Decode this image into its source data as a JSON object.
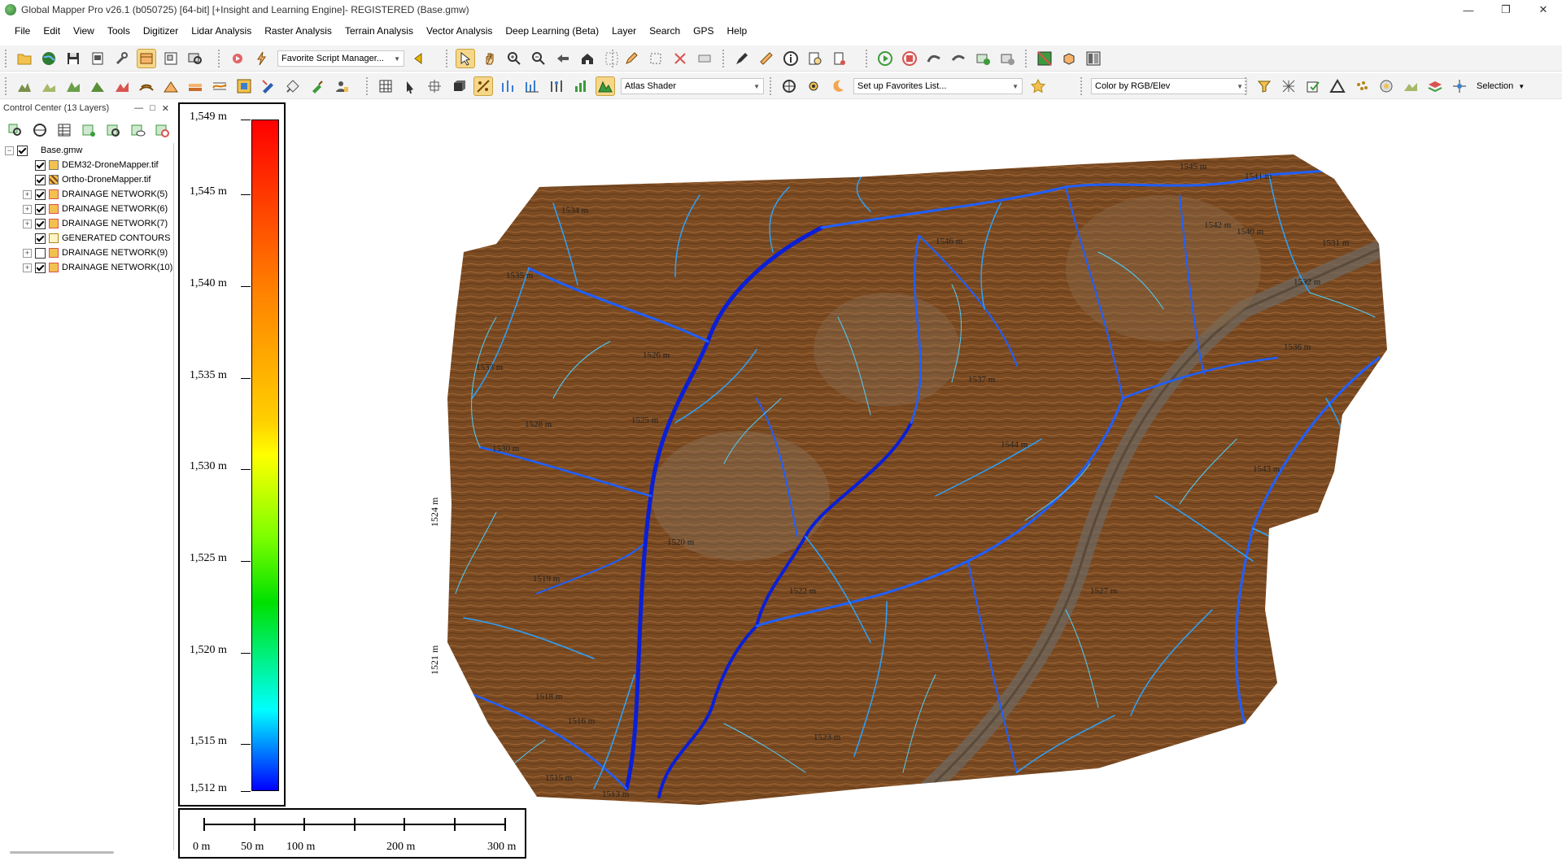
{
  "window": {
    "title": "Global Mapper Pro v26.1 (b050725) [64-bit] [+Insight and Learning Engine]- REGISTERED (Base.gmw)",
    "minimize": "—",
    "maximize": "❐",
    "close": "✕"
  },
  "menu": [
    "File",
    "Edit",
    "View",
    "Tools",
    "Digitizer",
    "Lidar Analysis",
    "Raster Analysis",
    "Terrain Analysis",
    "Vector Analysis",
    "Deep Learning (Beta)",
    "Layer",
    "Search",
    "GPS",
    "Help"
  ],
  "toolbar": {
    "script_combo": "Favorite Script Manager...",
    "shader_combo": "Atlas Shader",
    "favorites_combo": "Set up Favorites List...",
    "color_combo": "Color by RGB/Elev",
    "selection_label": "Selection"
  },
  "control_center": {
    "title": "Control Center (13 Layers)",
    "pin": "—",
    "float": "□",
    "close": "✕",
    "root": "Base.gmw",
    "layers": [
      {
        "name": "DEM32-DroneMapper.tif",
        "checked": true,
        "expandable": false
      },
      {
        "name": "Ortho-DroneMapper.tif",
        "checked": true,
        "expandable": false
      },
      {
        "name": "DRAINAGE NETWORK(5)",
        "checked": true,
        "expandable": true
      },
      {
        "name": "DRAINAGE NETWORK(6)",
        "checked": true,
        "expandable": true
      },
      {
        "name": "DRAINAGE NETWORK(7)",
        "checked": true,
        "expandable": true
      },
      {
        "name": "GENERATED CONTOURS",
        "checked": true,
        "expandable": false
      },
      {
        "name": "DRAINAGE NETWORK(9)",
        "checked": false,
        "expandable": true
      },
      {
        "name": "DRAINAGE NETWORK(10)",
        "checked": true,
        "expandable": true
      }
    ]
  },
  "legend": {
    "labels": [
      "1,549 m",
      "1,545 m",
      "1,540 m",
      "1,535 m",
      "1,530 m",
      "1,525 m",
      "1,520 m",
      "1,515 m",
      "1,512 m"
    ],
    "colors": {
      "top": "#ff0000",
      "mid": "#ffff00",
      "low": "#00ffff",
      "bottom": "#0000ff"
    }
  },
  "scalebar": {
    "labels": [
      "0 m",
      "50 m",
      "100 m",
      "200 m",
      "300 m"
    ]
  },
  "map": {
    "terrain_color": "#7a4a22",
    "stream_color": "#1f5fff",
    "side_labels": [
      "1524 m",
      "1521 m",
      "1526 m"
    ],
    "contour_labels": [
      "1541 m",
      "1545 m",
      "1542 m",
      "1540 m",
      "1531 m",
      "1532 m",
      "1536 m",
      "1535 m",
      "1534 m",
      "1533 m",
      "1530 m",
      "1528 m",
      "1526 m",
      "1525 m",
      "1522 m",
      "1520 m",
      "1519 m",
      "1518 m",
      "1516 m",
      "1515 m",
      "1513 m",
      "1523 m",
      "1537 m",
      "1544 m",
      "1546 m",
      "1543 m",
      "1527 m"
    ]
  }
}
